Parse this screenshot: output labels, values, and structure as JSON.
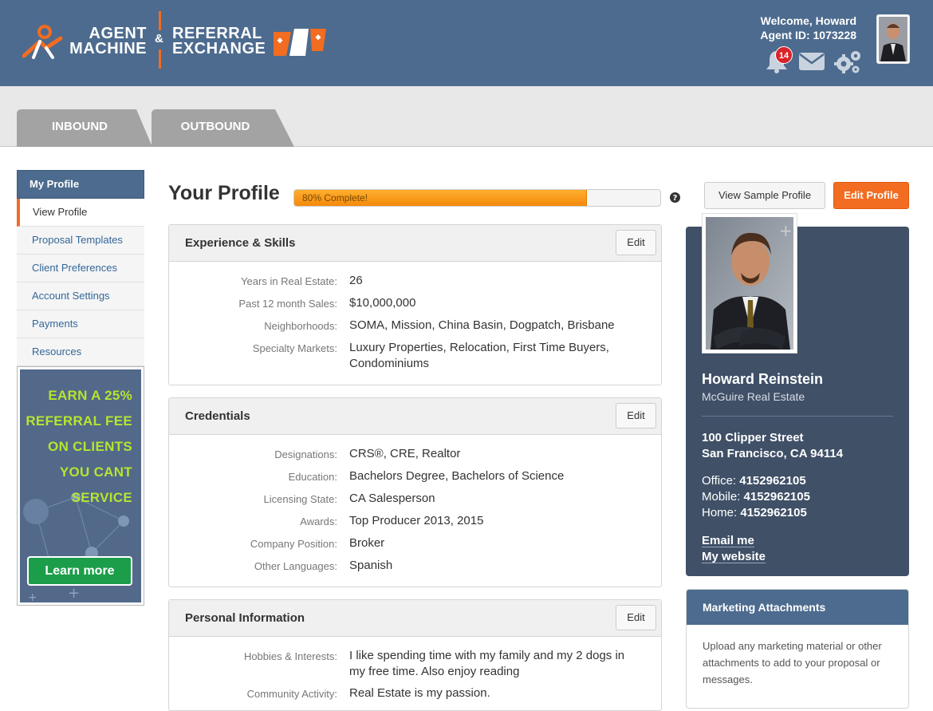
{
  "header": {
    "logo": {
      "agent_line1": "AGENT",
      "agent_line2": "MACHINE",
      "amp": "&",
      "ref_line1": "REFERRAL",
      "ref_line2": "EXCHANGE"
    },
    "welcome": "Welcome, Howard",
    "agent_id": "Agent ID: 1073228",
    "notifications_count": "14",
    "icons": [
      "bell-icon",
      "mail-icon",
      "gears-icon"
    ]
  },
  "tabs": [
    {
      "label": "INBOUND"
    },
    {
      "label": "OUTBOUND"
    }
  ],
  "sidebar": {
    "heading": "My Profile",
    "items": [
      {
        "label": "View Profile",
        "active": true
      },
      {
        "label": "Proposal Templates"
      },
      {
        "label": "Client Preferences"
      },
      {
        "label": "Account Settings"
      },
      {
        "label": "Payments"
      },
      {
        "label": "Resources"
      }
    ],
    "promo": {
      "lines": [
        "EARN A 25%",
        "REFERRAL FEE",
        "ON CLIENTS",
        "YOU CANT",
        "SERVICE"
      ],
      "button": "Learn more"
    }
  },
  "main": {
    "title": "Your Profile",
    "progress": {
      "percent": 80,
      "label": "80% Complete!"
    },
    "view_sample": "View Sample Profile",
    "edit_profile": "Edit Profile",
    "edit_label": "Edit",
    "experience": {
      "title": "Experience & Skills",
      "rows": [
        {
          "label": "Years in Real Estate:",
          "value": "26"
        },
        {
          "label": "Past 12 month Sales:",
          "value": "$10,000,000"
        },
        {
          "label": "Neighborhoods:",
          "value": "SOMA, Mission, China Basin, Dogpatch, Brisbane"
        },
        {
          "label": "Specialty Markets:",
          "value": "Luxury Properties, Relocation, First Time Buyers, Condominiums"
        }
      ]
    },
    "credentials": {
      "title": "Credentials",
      "rows": [
        {
          "label": "Designations:",
          "value": "CRS®, CRE, Realtor"
        },
        {
          "label": "Education:",
          "value": "Bachelors Degree, Bachelors of Science"
        },
        {
          "label": "Licensing State:",
          "value": "CA Salesperson"
        },
        {
          "label": "Awards:",
          "value": "Top Producer 2013, 2015"
        },
        {
          "label": "Company Position:",
          "value": "Broker"
        },
        {
          "label": "Other Languages:",
          "value": "Spanish"
        }
      ]
    },
    "personal": {
      "title": "Personal Information",
      "rows": [
        {
          "label": "Hobbies & Interests:",
          "value": "I like spending time with my family and my 2 dogs in my free time. Also enjoy reading"
        },
        {
          "label": "Community Activity:",
          "value": "Real Estate is my passion."
        }
      ]
    }
  },
  "profile_card": {
    "name": "Howard Reinstein",
    "company": "McGuire Real Estate",
    "address_line1": "100 Clipper Street",
    "address_line2": "San Francisco, CA 94114",
    "office_label": "Office:",
    "office": "4152962105",
    "mobile_label": "Mobile:",
    "mobile": "4152962105",
    "home_label": "Home:",
    "home": "4152962105",
    "email_link": "Email me",
    "website_link": "My website"
  },
  "marketing": {
    "title": "Marketing Attachments",
    "body": "Upload any marketing material or other attachments to add to your proposal or messages."
  },
  "colors": {
    "header": "#4d6b8e",
    "accent": "#f26c21",
    "card": "#3f5067",
    "promo_text": "#b6e52e",
    "promo_button": "#1c9d4a"
  }
}
